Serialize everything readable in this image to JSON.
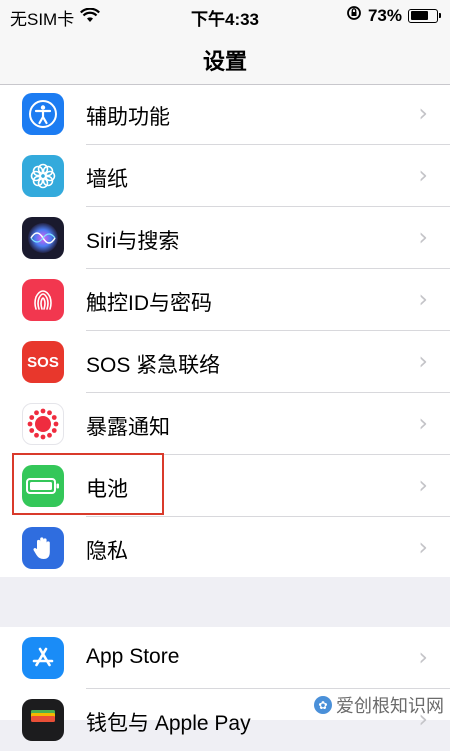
{
  "status_bar": {
    "carrier": "无SIM卡",
    "time": "下午4:33",
    "battery_percent": "73%",
    "battery_level": 0.73
  },
  "nav": {
    "title": "设置"
  },
  "section1": [
    {
      "label": "辅助功能",
      "icon": "accessibility-icon",
      "color": "#1c7cf2"
    },
    {
      "label": "墙纸",
      "icon": "wallpaper-flower-icon",
      "color": "#33aadc"
    },
    {
      "label": "Siri与搜索",
      "icon": "siri-icon",
      "color": "#1a1a2e"
    },
    {
      "label": "触控ID与密码",
      "icon": "fingerprint-icon",
      "color": "#f2374f"
    },
    {
      "label": "SOS 紧急联络",
      "icon": "sos-icon",
      "icon_text": "SOS",
      "color": "#e8372c"
    },
    {
      "label": "暴露通知",
      "icon": "exposure-notification-icon",
      "color": "#ffffff"
    },
    {
      "label": "电池",
      "icon": "battery-icon",
      "color": "#34c759"
    },
    {
      "label": "隐私",
      "icon": "privacy-hand-icon",
      "color": "#2f6ddf"
    }
  ],
  "section2": [
    {
      "label": "App Store",
      "icon": "app-store-icon",
      "color": "#1a8cf7"
    },
    {
      "label": "钱包与 Apple Pay",
      "icon": "wallet-icon",
      "color": "#1c1c1e"
    }
  ],
  "watermark": {
    "text": "爱创根知识网"
  }
}
